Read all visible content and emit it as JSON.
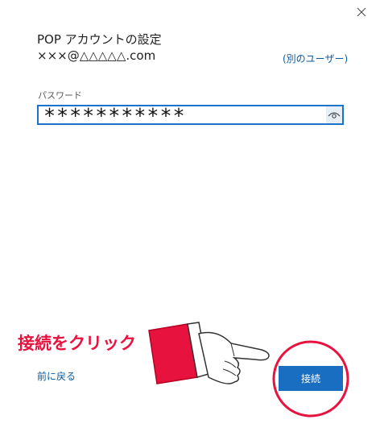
{
  "dialog": {
    "title": "POP アカウントの設定",
    "email": "×××@△△△△△.com",
    "other_user_link": "(別のユーザー)",
    "password_label": "パスワード",
    "password_value": "***********",
    "back_link": "前に戻る",
    "connect_button": "接続"
  },
  "annotation": {
    "text": "接続をクリック",
    "color": "#e8123f"
  },
  "icons": {
    "close": "close-icon",
    "show_password": "eye-icon",
    "pointer": "pointing-hand-icon"
  },
  "colors": {
    "accent": "#1a6ec2",
    "link": "#0a5a9e",
    "annotation": "#e8123f"
  }
}
